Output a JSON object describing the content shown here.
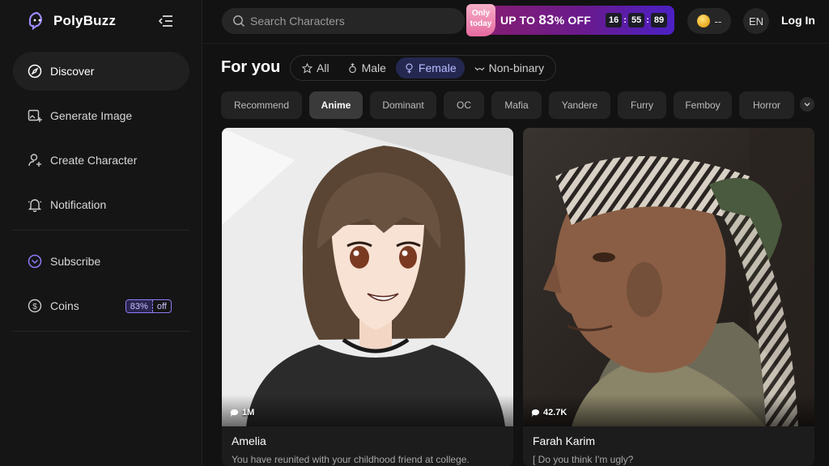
{
  "app": {
    "name": "PolyBuzz"
  },
  "sidebar": {
    "items": [
      {
        "label": "Discover",
        "icon": "compass-icon"
      },
      {
        "label": "Generate Image",
        "icon": "image-plus-icon"
      },
      {
        "label": "Create Character",
        "icon": "user-plus-icon"
      },
      {
        "label": "Notification",
        "icon": "bell-icon"
      }
    ],
    "subscribe_label": "Subscribe",
    "coins_label": "Coins",
    "coins_badge": {
      "percent": "83%",
      "off": "off"
    }
  },
  "topbar": {
    "search_placeholder": "Search Characters",
    "promo": {
      "tag_line1": "Only",
      "tag_line2": "today",
      "text_prefix": "UP TO",
      "discount": "83",
      "text_suffix": "% OFF",
      "timer": [
        "16",
        "55",
        "89"
      ]
    },
    "coins_value": "--",
    "language": "EN",
    "login_label": "Log In"
  },
  "feed": {
    "title": "For you",
    "gender_tabs": [
      {
        "label": "All",
        "icon": "star-icon"
      },
      {
        "label": "Male",
        "icon": "male-icon"
      },
      {
        "label": "Female",
        "icon": "female-icon"
      },
      {
        "label": "Non-binary",
        "icon": "nonbinary-icon"
      }
    ],
    "active_gender": "Female",
    "categories": [
      "Recommend",
      "Anime",
      "Dominant",
      "OC",
      "Mafia",
      "Yandere",
      "Furry",
      "Femboy",
      "Horror"
    ],
    "active_category": "Anime",
    "cards": [
      {
        "stat": "1M",
        "name": "Amelia",
        "desc": "You have reunited with your childhood friend at college."
      },
      {
        "stat": "42.7K",
        "name": "Farah Karim",
        "desc": "[ Do you think I'm ugly?"
      }
    ]
  },
  "colors": {
    "accent": "#8b7cf5",
    "active_tab_bg": "#242850",
    "promo_start": "#8a1e6e",
    "promo_end": "#4b20c4"
  }
}
